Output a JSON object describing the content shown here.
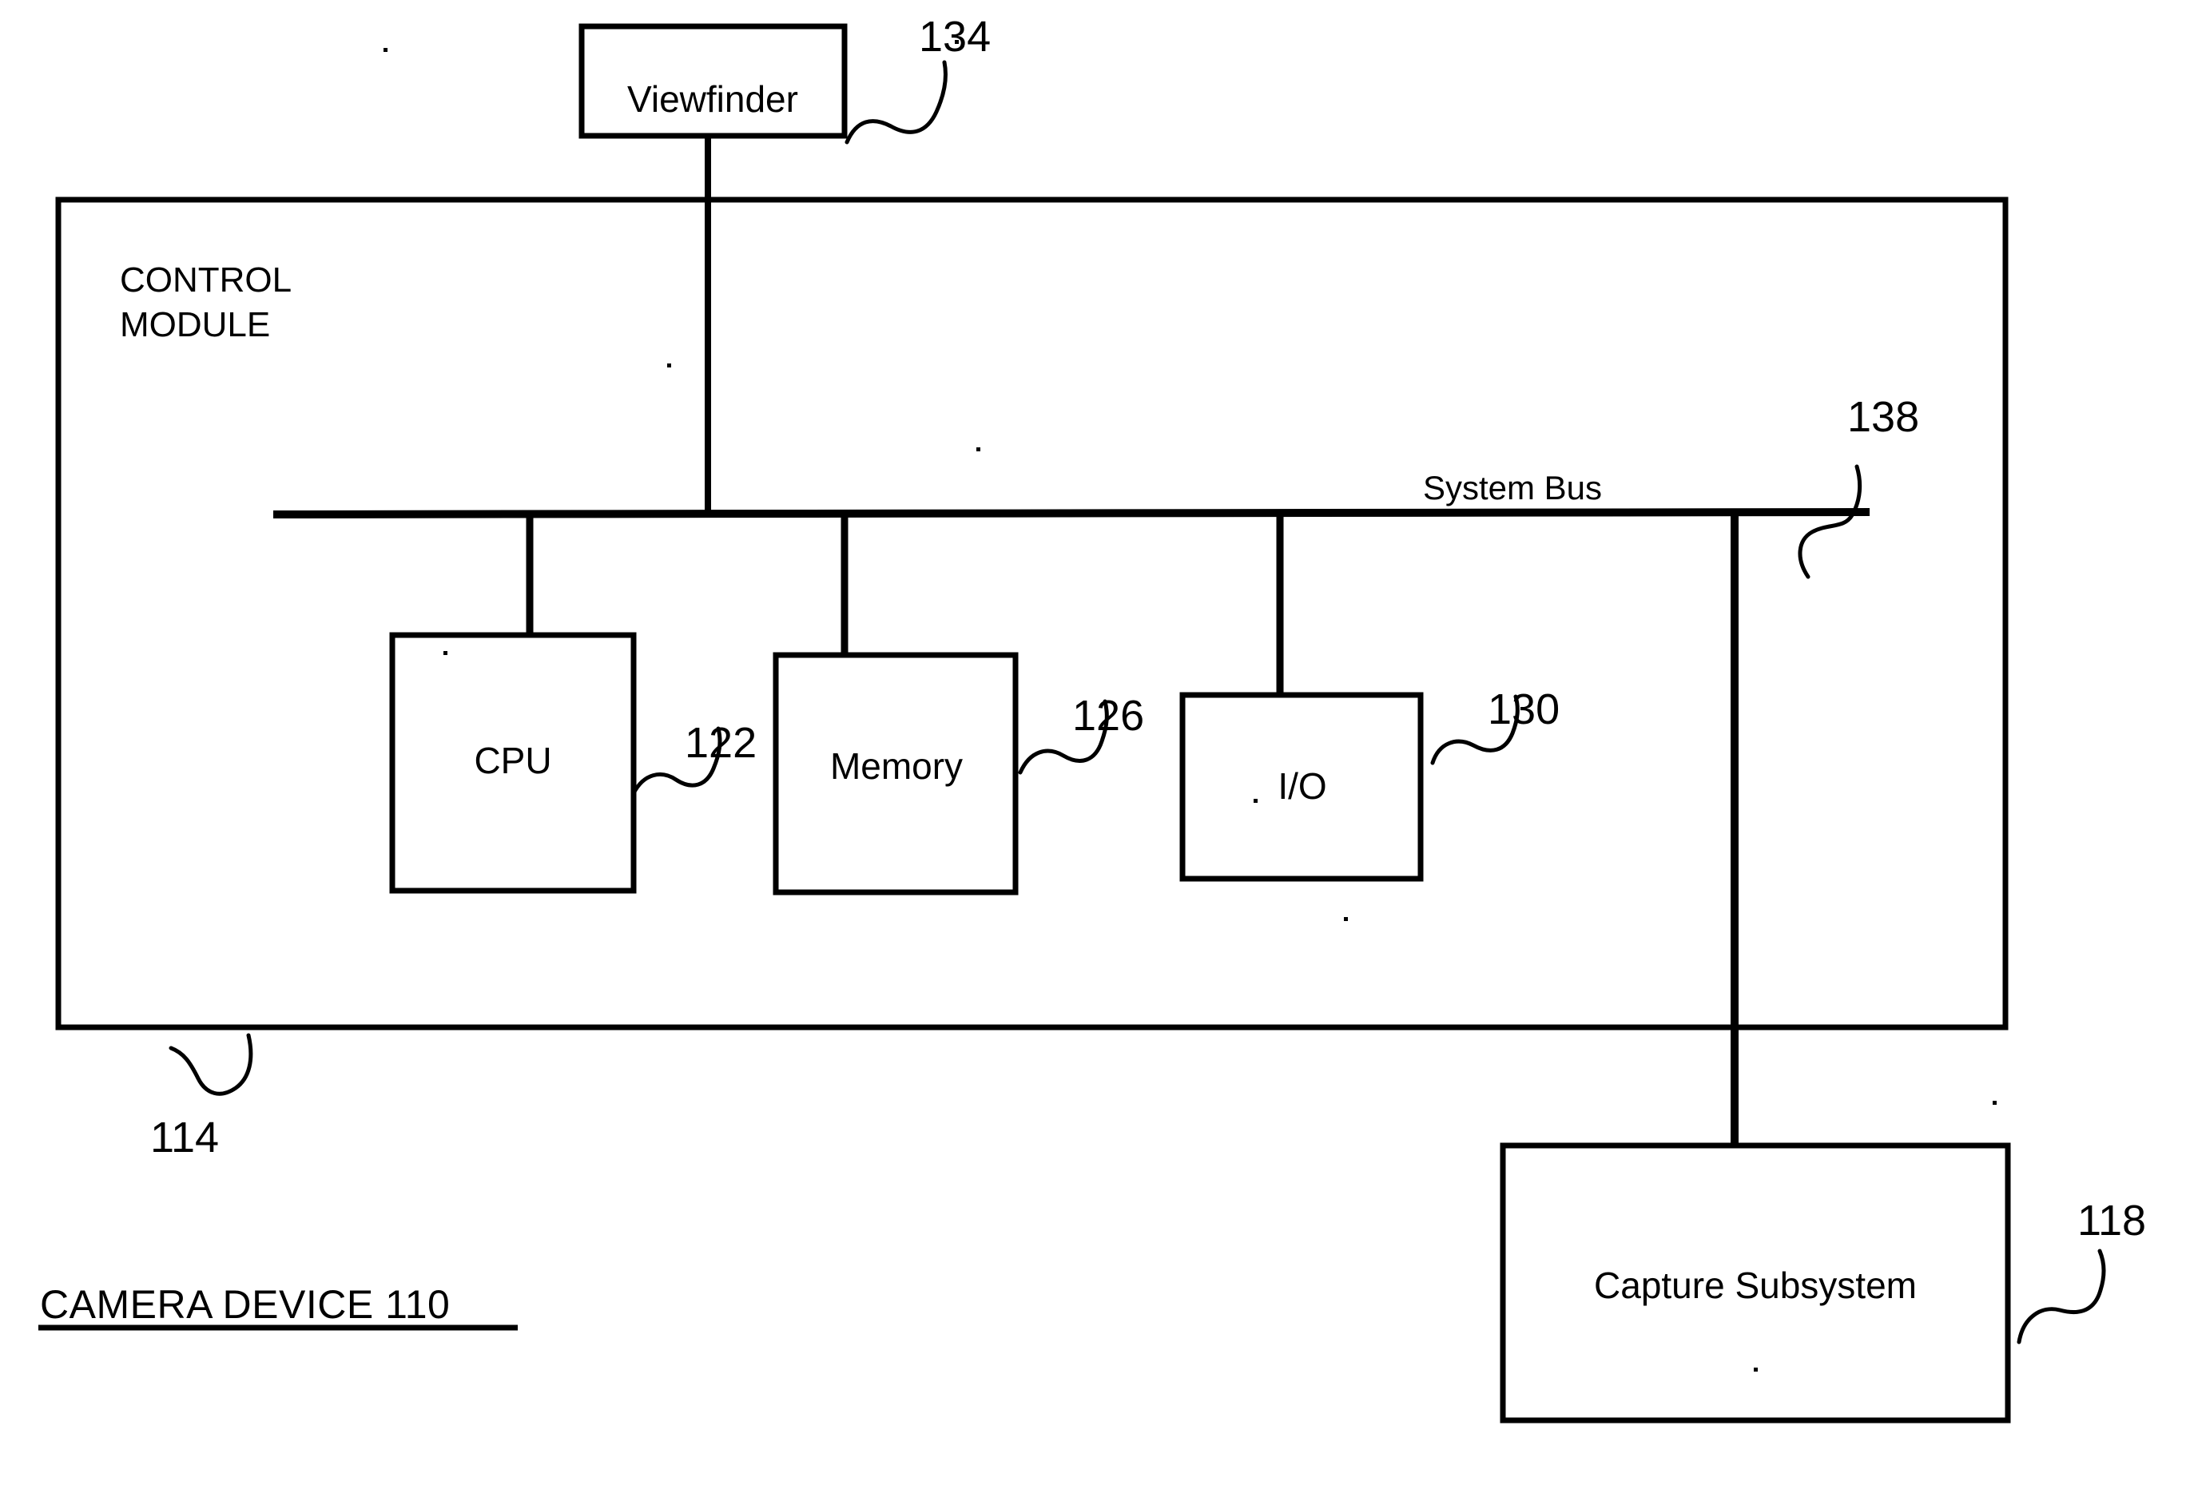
{
  "figure": {
    "caption": "CAMERA DEVICE 110",
    "background_color": "#ffffff",
    "ink_color": "#000000"
  },
  "blocks": {
    "viewfinder": {
      "label": "Viewfinder",
      "ref": "134"
    },
    "control_module": {
      "label_line1": "CONTROL",
      "label_line2": "MODULE",
      "ref": "114"
    },
    "cpu": {
      "label": "CPU",
      "ref": "122"
    },
    "memory": {
      "label": "Memory",
      "ref": "126"
    },
    "io": {
      "label": "I/O",
      "ref": "130"
    },
    "capture_subsystem": {
      "label": "Capture Subsystem",
      "ref": "118"
    }
  },
  "bus": {
    "label": "System Bus",
    "ref": "138"
  }
}
